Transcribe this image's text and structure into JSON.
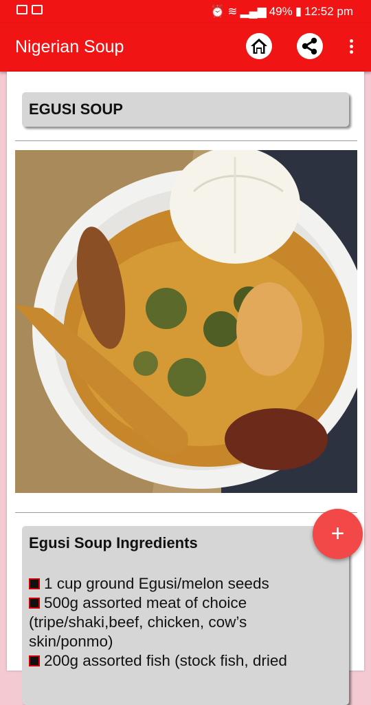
{
  "status_bar": {
    "battery": "49%",
    "time": "12:52 pm"
  },
  "app_bar": {
    "title": "Nigerian Soup",
    "home_icon": "home-icon",
    "share_icon": "share-icon",
    "overflow_icon": "more-vert-icon"
  },
  "soup": {
    "title": "EGUSI SOUP",
    "ingredients_title": "Egusi Soup Ingredients",
    "ingredients": [
      "1 cup ground Egusi/melon seeds",
      "500g assorted meat of choice (tripe/shaki,beef, chicken, cow’s skin/ponmo)",
      "200g assorted fish (stock fish, dried"
    ]
  },
  "fab": {
    "label": "+"
  },
  "colors": {
    "primary": "#f01414",
    "fab": "#f24848",
    "background": "#f4c9d2",
    "card_box": "#d6d6d6"
  }
}
